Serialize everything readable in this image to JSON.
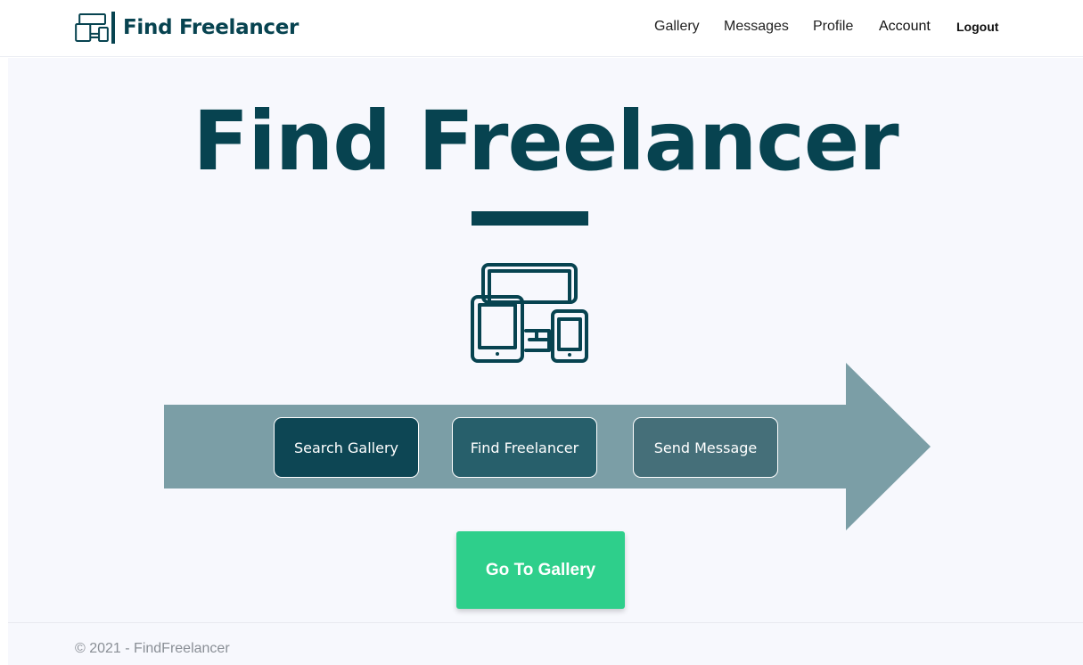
{
  "header": {
    "brand_name": "Find Freelancer",
    "brand_icon": "devices-icon",
    "nav": {
      "gallery": "Gallery",
      "messages": "Messages",
      "profile": "Profile",
      "account": "Account",
      "logout": "Logout"
    }
  },
  "hero": {
    "title": "Find Freelancer",
    "icon": "devices-icon",
    "steps": [
      "Search Gallery",
      "Find Freelancer",
      "Send Message"
    ],
    "cta_label": "Go To Gallery"
  },
  "footer": {
    "copyright": "© 2021 - FindFreelancer"
  },
  "colors": {
    "brand": "#074350",
    "arrow": "#7b9ea6",
    "cta": "#2ecf8b",
    "step_1": "#0d4654",
    "step_2": "#275f6b",
    "step_3": "#456f79",
    "page_background": "#f7f8fd"
  }
}
